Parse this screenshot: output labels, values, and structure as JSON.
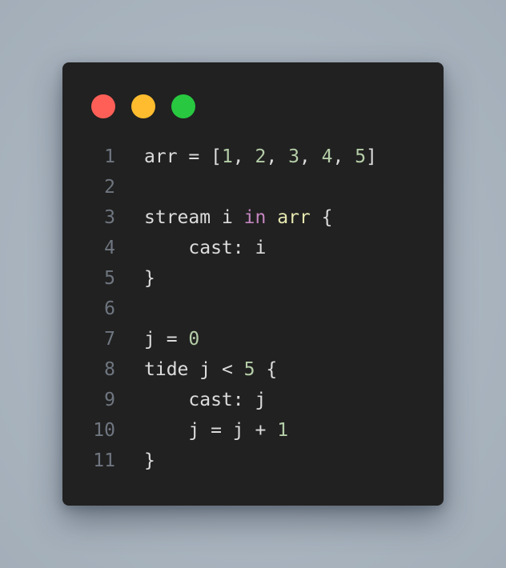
{
  "window": {
    "controls": [
      {
        "name": "close",
        "color": "#ff5f57"
      },
      {
        "name": "minimize",
        "color": "#febc2e"
      },
      {
        "name": "maximize",
        "color": "#28c840"
      }
    ]
  },
  "code": {
    "lines": [
      {
        "number": "1",
        "text": "arr = [1, 2, 3, 4, 5]"
      },
      {
        "number": "2",
        "text": ""
      },
      {
        "number": "3",
        "text": "stream i in arr {"
      },
      {
        "number": "4",
        "text": "    cast: i"
      },
      {
        "number": "5",
        "text": "}"
      },
      {
        "number": "6",
        "text": ""
      },
      {
        "number": "7",
        "text": "j = 0"
      },
      {
        "number": "8",
        "text": "tide j < 5 {"
      },
      {
        "number": "9",
        "text": "    cast: j"
      },
      {
        "number": "10",
        "text": "    j = j + 1"
      },
      {
        "number": "11",
        "text": "}"
      }
    ]
  }
}
